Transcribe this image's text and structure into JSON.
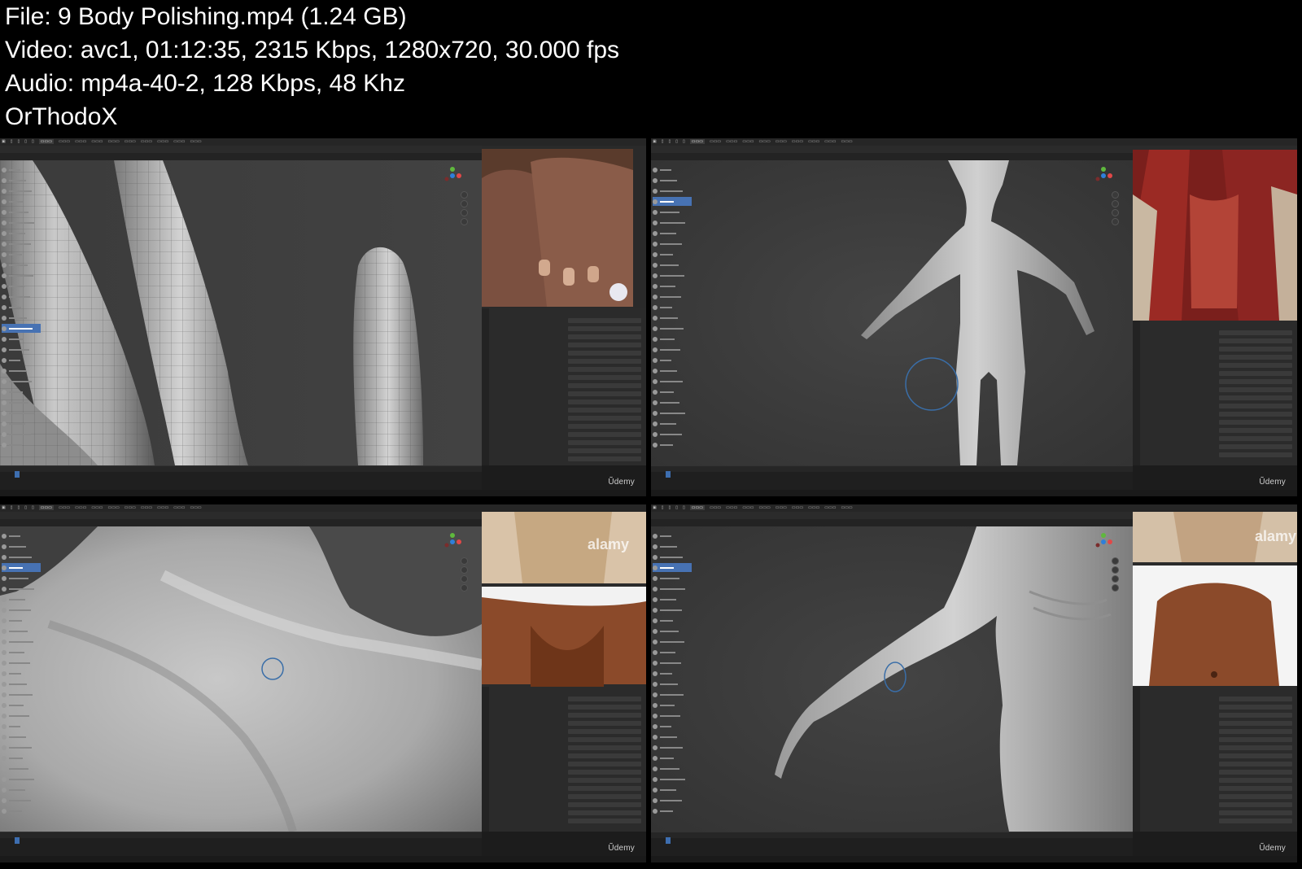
{
  "header": {
    "line1": "File: 9  Body Polishing.mp4 (1.24 GB)",
    "line2": "Video: avc1, 01:12:35, 2315 Kbps, 1280x720, 30.000 fps",
    "line3": "Audio: mp4a-40-2, 128 Kbps, 48 Khz",
    "line4": "OrThodoX"
  },
  "colors": {
    "background": "#000000",
    "header_text": "#ffffff",
    "blender_bg": "#1c1c1c",
    "selected_tool": "#4772b3",
    "brush_ring": "#3a6ea8"
  },
  "frames": [
    {
      "watermark": "Ũdemy",
      "selected_tool": "Snake Hook",
      "reference": "aged-hands-photo"
    },
    {
      "watermark": "Ũdemy",
      "selected_tool": "Clay Strips",
      "reference": "muscle-anatomy-image"
    },
    {
      "watermark": "Ũdemy",
      "selected_tool": "Clay Strips",
      "reference_watermark": "alamy"
    },
    {
      "watermark": "Ũdemy",
      "selected_tool": "Clay Strips",
      "reference_watermark": "alamy"
    }
  ]
}
